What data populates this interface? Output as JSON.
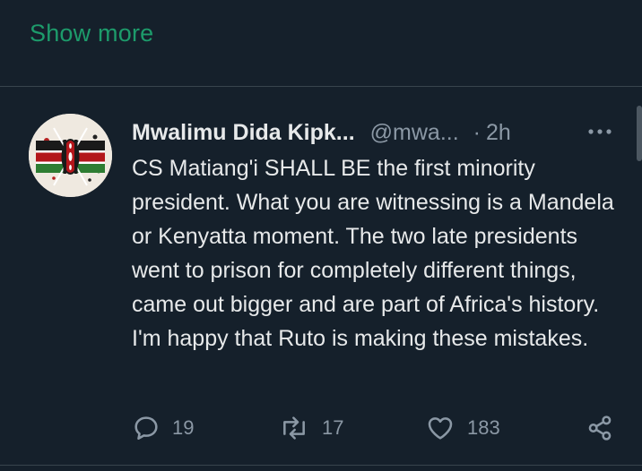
{
  "thread": {
    "show_more_label": "Show more"
  },
  "tweet": {
    "author_name": "Mwalimu Dida Kipk...",
    "handle": "@mwa...",
    "separator": "·",
    "time": "2h",
    "text": "CS Matiang'i SHALL BE the first minority president. What you are witnessing is a Mandela or Kenyatta moment. The two late presidents went to prison for completely different things, came out bigger and are part of Africa's history. I'm happy that Ruto is making these mistakes.",
    "avatar_icon": "kenya-flag-shield-icon",
    "more_icon": "more-horizontal-icon",
    "actions": {
      "replies": {
        "icon": "reply-icon",
        "count": "19"
      },
      "reposts": {
        "icon": "repost-icon",
        "count": "17"
      },
      "likes": {
        "icon": "heart-icon",
        "count": "183"
      },
      "share": {
        "icon": "share-icon"
      }
    }
  },
  "colors": {
    "background": "#15202b",
    "accent_green": "#1d9b6b",
    "text_primary": "#e7e9ea",
    "text_secondary": "#8b98a5",
    "divider": "#38444d"
  }
}
